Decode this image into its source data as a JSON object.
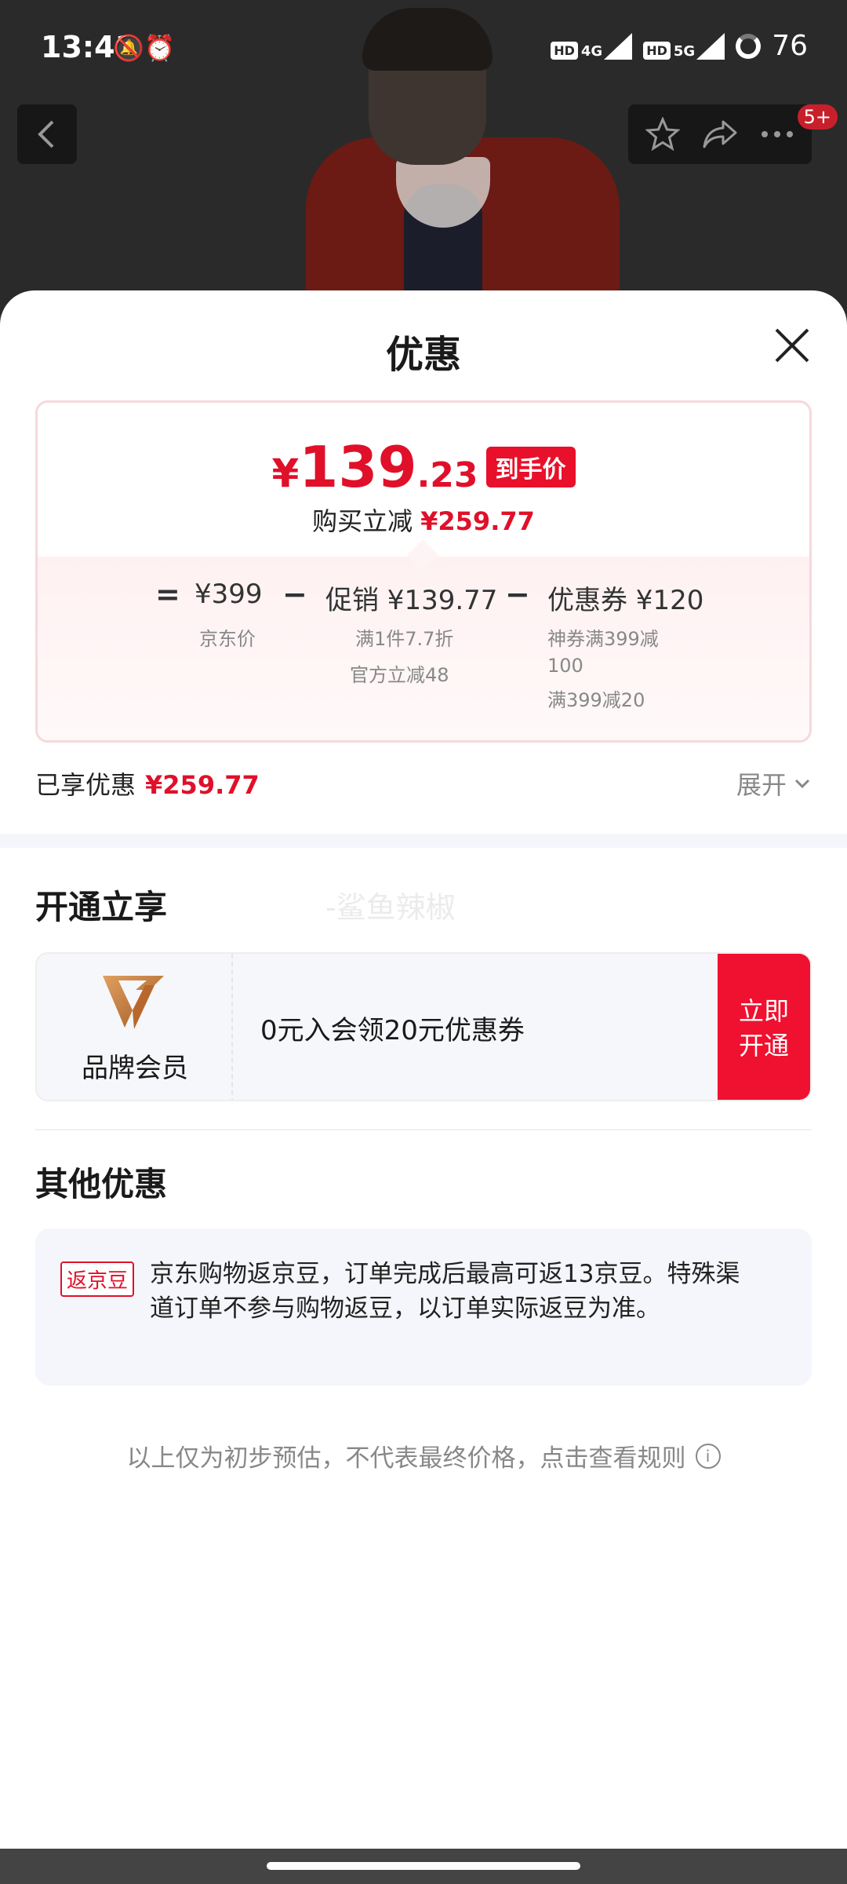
{
  "status_bar": {
    "time": "13:41",
    "left_icons": "🔕⏰",
    "sim1_hd": "HD",
    "sim1_net": "4G",
    "sim2_hd": "HD",
    "sim2_net": "5G",
    "battery": "76"
  },
  "nav": {
    "badge": "5+"
  },
  "sheet": {
    "title": "优惠",
    "price": {
      "currency": "¥",
      "integer": "139",
      "decimal": ".23",
      "tag": "到手价",
      "save_label": "购买立减",
      "save_amount": "¥259.77"
    },
    "calc": {
      "equals": "=",
      "jd_price": "¥399",
      "jd_price_label": "京东价",
      "minus1": "−",
      "promo": "促销 ¥139.77",
      "promo_detail_1": "满1件7.7折",
      "promo_detail_2": "官方立减48",
      "minus2": "−",
      "coupon": "优惠券 ¥120",
      "coupon_detail_1": "神券满399减",
      "coupon_detail_2": "100",
      "coupon_detail_3": "满399减20"
    },
    "enjoyed": {
      "label": "已享优惠",
      "amount": "¥259.77",
      "expand": "展开"
    },
    "open_section": {
      "title": "开通立享",
      "watermark": "-鲨鱼辣椒",
      "member_label": "品牌会员",
      "offer": "0元入会领20元优惠券",
      "button_line1": "立即",
      "button_line2": "开通"
    },
    "other_section": {
      "title": "其他优惠",
      "tag": "返京豆",
      "text": "京东购物返京豆，订单完成后最高可返13京豆。特殊渠道订单不参与购物返豆，以订单实际返豆为准。"
    },
    "footnote": "以上仅为初步预估，不代表最终价格，点击查看规则"
  },
  "colors": {
    "accent_red": "#e0102a",
    "button_red": "#f0102f",
    "muted_gray": "#888888",
    "member_gold": "#c57a3a"
  }
}
